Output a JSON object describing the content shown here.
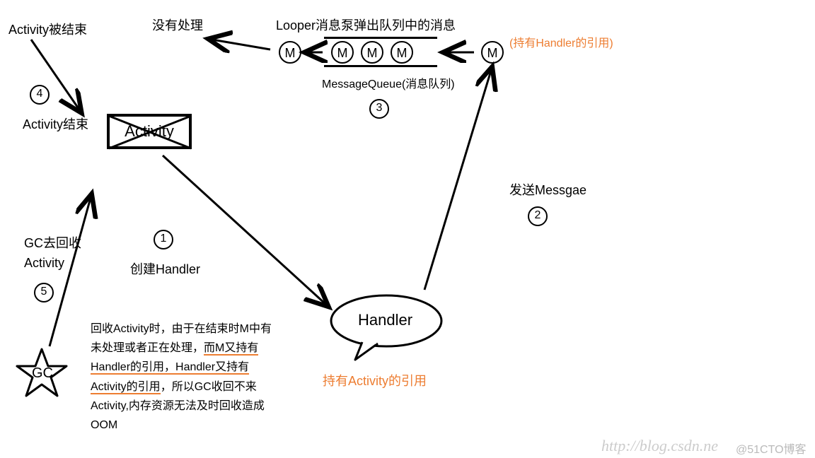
{
  "labels": {
    "activity_ended_top": "Activity被结束",
    "activity_end": "Activity结束",
    "activity_box": "Activity",
    "no_handle": "没有处理",
    "looper_title": "Looper消息泵弹出队列中的消息",
    "m": "M",
    "hold_handler_ref": "(持有Handler的引用)",
    "message_queue": "MessageQueue(消息队列)",
    "send_message": "发送Messgae",
    "create_handler": "创建Handler",
    "gc_recycle": "GC去回收",
    "gc_recycle2": "Activity",
    "handler": "Handler",
    "hold_activity_ref": "持有Activity的引用",
    "gc": "GC",
    "paragraph_l1a": "回收Activity时，由于在结束时M中有",
    "paragraph_l2a": "未处理或者正在处理，",
    "paragraph_l2b": "而M又持有",
    "paragraph_l3a": "Handler的引用，Handler又持有",
    "paragraph_l4a": "Activity的引用",
    "paragraph_l4b": "，所以GC收回不来",
    "paragraph_l5a": "Activity,内存资源无法及时回收造成",
    "paragraph_l6a": "OOM",
    "watermark": "http://blog.csdn.ne",
    "watermark2": "@51CTO博客"
  },
  "steps": {
    "s1": "1",
    "s2": "2",
    "s3": "3",
    "s4": "4",
    "s5": "5"
  }
}
